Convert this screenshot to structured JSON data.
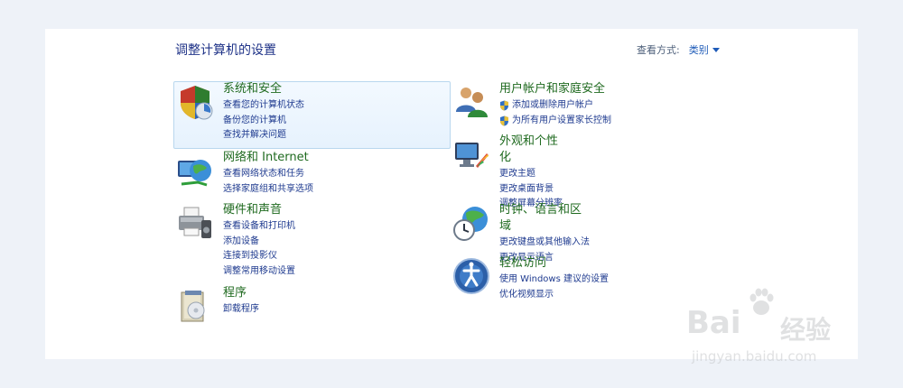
{
  "page_title": "调整计算机的设置",
  "view": {
    "label": "查看方式:",
    "mode": "类别"
  },
  "categories": {
    "system": {
      "heading": "系统和安全",
      "links": [
        "查看您的计算机状态",
        "备份您的计算机",
        "查找并解决问题"
      ]
    },
    "network": {
      "heading": "网络和 Internet",
      "links": [
        "查看网络状态和任务",
        "选择家庭组和共享选项"
      ]
    },
    "hardware": {
      "heading": "硬件和声音",
      "links": [
        "查看设备和打印机",
        "添加设备",
        "连接到投影仪",
        "调整常用移动设置"
      ]
    },
    "programs": {
      "heading": "程序",
      "links": [
        "卸载程序"
      ]
    },
    "users": {
      "heading": "用户帐户和家庭安全",
      "links": [
        "添加或删除用户帐户",
        "为所有用户设置家长控制"
      ]
    },
    "appearance": {
      "heading": "外观和个性化",
      "links": [
        "更改主题",
        "更改桌面背景",
        "调整屏幕分辨率"
      ]
    },
    "clock": {
      "heading": "时钟、语言和区域",
      "links": [
        "更改键盘或其他输入法",
        "更改显示语言"
      ]
    },
    "ease": {
      "heading": "轻松访问",
      "links": [
        "使用 Windows 建议的设置",
        "优化视频显示"
      ]
    }
  },
  "watermark": {
    "brand_left": "Bai",
    "brand_right": "经验",
    "url": "jingyan.baidu.com"
  },
  "colors": {
    "heading": "#1f6a1f",
    "link": "#1e3a8f",
    "title": "#1e3287"
  }
}
